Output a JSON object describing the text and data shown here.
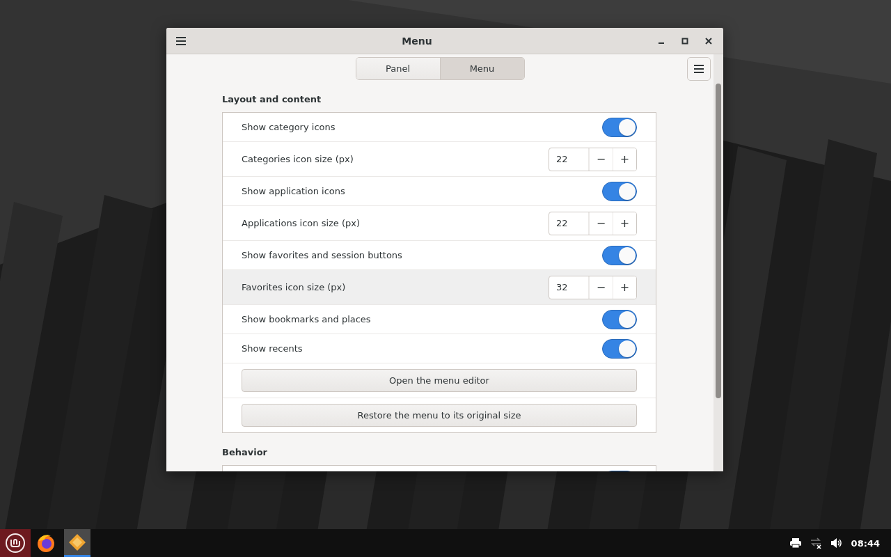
{
  "window": {
    "title": "Menu"
  },
  "tabs": [
    {
      "label": "Panel",
      "selected": false
    },
    {
      "label": "Menu",
      "selected": true
    }
  ],
  "sections": [
    {
      "title": "Layout and content",
      "rows": [
        {
          "kind": "switch",
          "label": "Show category icons",
          "on": true
        },
        {
          "kind": "spin",
          "label": "Categories icon size (px)",
          "value": "22",
          "minus": "−",
          "plus": "+",
          "hovered": false
        },
        {
          "kind": "switch",
          "label": "Show application icons",
          "on": true
        },
        {
          "kind": "spin",
          "label": "Applications icon size (px)",
          "value": "22",
          "minus": "−",
          "plus": "+",
          "hovered": false
        },
        {
          "kind": "switch",
          "label": "Show favorites and session buttons",
          "on": true
        },
        {
          "kind": "spin",
          "label": "Favorites icon size (px)",
          "value": "32",
          "minus": "−",
          "plus": "+",
          "hovered": true
        },
        {
          "kind": "switch",
          "label": "Show bookmarks and places",
          "on": true
        },
        {
          "kind": "switch",
          "label": "Show recents",
          "on": true
        },
        {
          "kind": "button",
          "label": "Open the menu editor"
        },
        {
          "kind": "button",
          "label": "Restore the menu to its original size"
        }
      ]
    },
    {
      "title": "Behavior",
      "rows": [
        {
          "kind": "switch",
          "on": true
        }
      ]
    }
  ],
  "taskbar": {
    "clock": "08:44"
  }
}
